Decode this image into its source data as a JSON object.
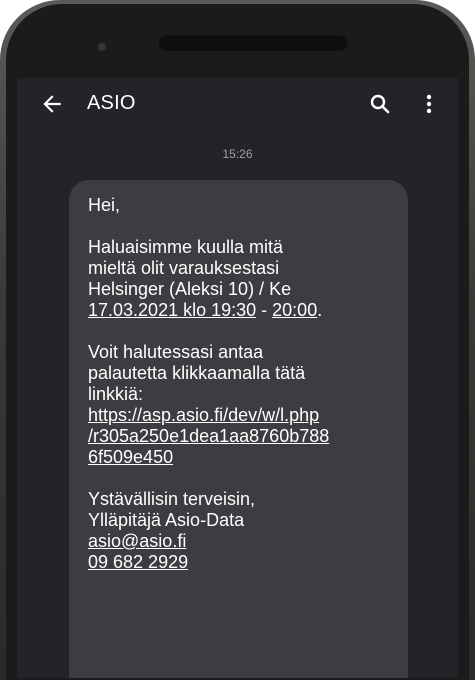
{
  "appbar": {
    "title": "ASIO",
    "back_icon": "arrow-left-icon",
    "search_icon": "search-icon",
    "more_icon": "more-vertical-icon"
  },
  "timestamp": "15:26",
  "message": {
    "greeting": "Hei,",
    "intro_lines": [
      "Haluaisimme kuulla mitä",
      "mieltä olit varauksestasi",
      "Helsinger (Aleksi 10) / Ke"
    ],
    "datetime_start": "17.03.2021 klo 19:30",
    "datetime_sep": " - ",
    "datetime_end": "20:00",
    "datetime_end_punct": ".",
    "feedback_lines": [
      "Voit halutessasi antaa",
      "palautetta klikkaamalla tätä",
      "linkkiä:"
    ],
    "link_lines": [
      "https://asp.asio.fi/dev/w/l.php",
      "/r305a250e1dea1aa8760b788",
      "6f509e450"
    ],
    "sign_lines": [
      "Ystävällisin terveisin,",
      "Ylläpitäjä Asio-Data"
    ],
    "email": "asio@asio.fi",
    "phone": "09 682 2929"
  },
  "colors": {
    "screen_bg": "#242428",
    "bubble_bg": "#3c3c41",
    "text": "#ffffff",
    "timestamp": "#9aa0a6"
  }
}
